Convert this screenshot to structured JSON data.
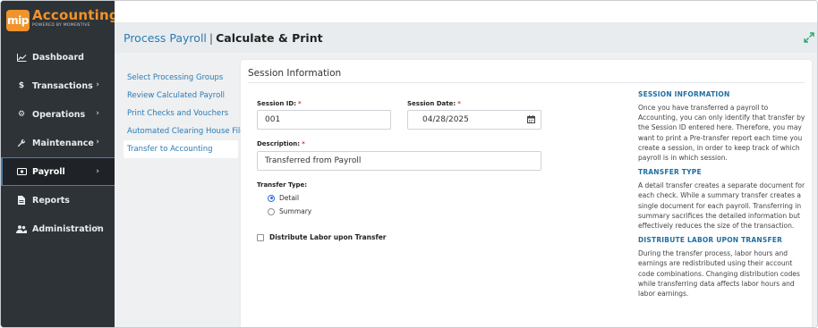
{
  "brand": {
    "badge": "mip",
    "title": "Accounting",
    "subtitle": "POWERED BY MOMENTIVE",
    "badge_color": "#f0932b"
  },
  "sidebar": {
    "items": [
      {
        "label": "Dashboard",
        "icon": "chart-icon",
        "has_chevron": false
      },
      {
        "label": "Transactions",
        "icon": "dollar-icon",
        "has_chevron": true
      },
      {
        "label": "Operations",
        "icon": "gears-icon",
        "has_chevron": true
      },
      {
        "label": "Maintenance",
        "icon": "wrench-icon",
        "has_chevron": true
      },
      {
        "label": "Payroll",
        "icon": "money-icon",
        "has_chevron": true,
        "active": true
      },
      {
        "label": "Reports",
        "icon": "document-icon",
        "has_chevron": false
      },
      {
        "label": "Administration",
        "icon": "users-icon",
        "has_chevron": true
      }
    ]
  },
  "header": {
    "title": "Process Payroll",
    "separator": "|",
    "subtitle": "Calculate & Print"
  },
  "steps": [
    {
      "label": "Select Processing Groups"
    },
    {
      "label": "Review Calculated Payroll"
    },
    {
      "label": "Print Checks and Vouchers"
    },
    {
      "label": "Automated Clearing House File"
    },
    {
      "label": "Transfer to Accounting",
      "active": true
    }
  ],
  "form": {
    "section_title": "Session Information",
    "session_id_label": "Session ID:",
    "session_id_value": "001",
    "session_date_label": "Session Date:",
    "session_date_value": "04/28/2025",
    "description_label": "Description:",
    "description_value": "Transferred from Payroll",
    "required_mark": "*",
    "transfer_type_label": "Transfer Type:",
    "transfer_options": [
      "Detail",
      "Summary"
    ],
    "transfer_selected": "Detail",
    "distribute_label": "Distribute Labor upon Transfer",
    "distribute_checked": false
  },
  "help": {
    "sections": [
      {
        "heading": "SESSION INFORMATION",
        "body": "Once you have transferred a payroll to Accounting, you can only identify that transfer by the Session ID entered here. Therefore, you may want to print a Pre-transfer report each time you create a session, in order to keep track of which payroll is in which session."
      },
      {
        "heading": "TRANSFER TYPE",
        "body": "A detail transfer creates a separate document for each check. While a summary transfer creates a single document for each payroll. Transferring in summary sacrifices the detailed information but effectively reduces the size of the transaction."
      },
      {
        "heading": "DISTRIBUTE LABOR UPON TRANSFER",
        "body": "During the transfer process, labor hours and earnings are redistributed using their account code combinations. Changing distribution codes while transferring data affects labor hours and labor earnings."
      }
    ]
  },
  "colors": {
    "sidebar_bg": "#2e3338",
    "link": "#2b7bb3",
    "required": "#d9343a",
    "help_heading": "#1f6fa3"
  }
}
